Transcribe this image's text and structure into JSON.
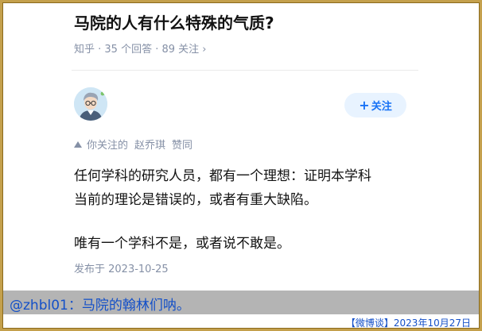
{
  "question": {
    "title": "马院的人有什么特殊的气质?",
    "meta": "知乎 · 35 个回答 · 89 关注 ›"
  },
  "answer": {
    "follow_button": {
      "icon": "+",
      "label": "关注"
    },
    "upvote_info": {
      "prefix": "你关注的",
      "user": "赵乔琪",
      "action": "赞同"
    },
    "paragraphs": [
      "任何学科的研究人员，都有一个理想：证明本学科",
      "当前的理论是错误的，或者有重大缺陷。",
      "唯有一个学科不是，或者说不敢是。"
    ],
    "published": "发布于 2023-10-25"
  },
  "overlay": {
    "caption": "@zhbl01：马院的翰林们呐。",
    "footer": "【微博谈】2023年10月27日"
  },
  "colors": {
    "frame": "#c4a04c",
    "accent_blue": "#1772f6",
    "caption_text": "#1450c8",
    "caption_bar": "#b4b4b4",
    "meta_gray": "#8590a6"
  }
}
